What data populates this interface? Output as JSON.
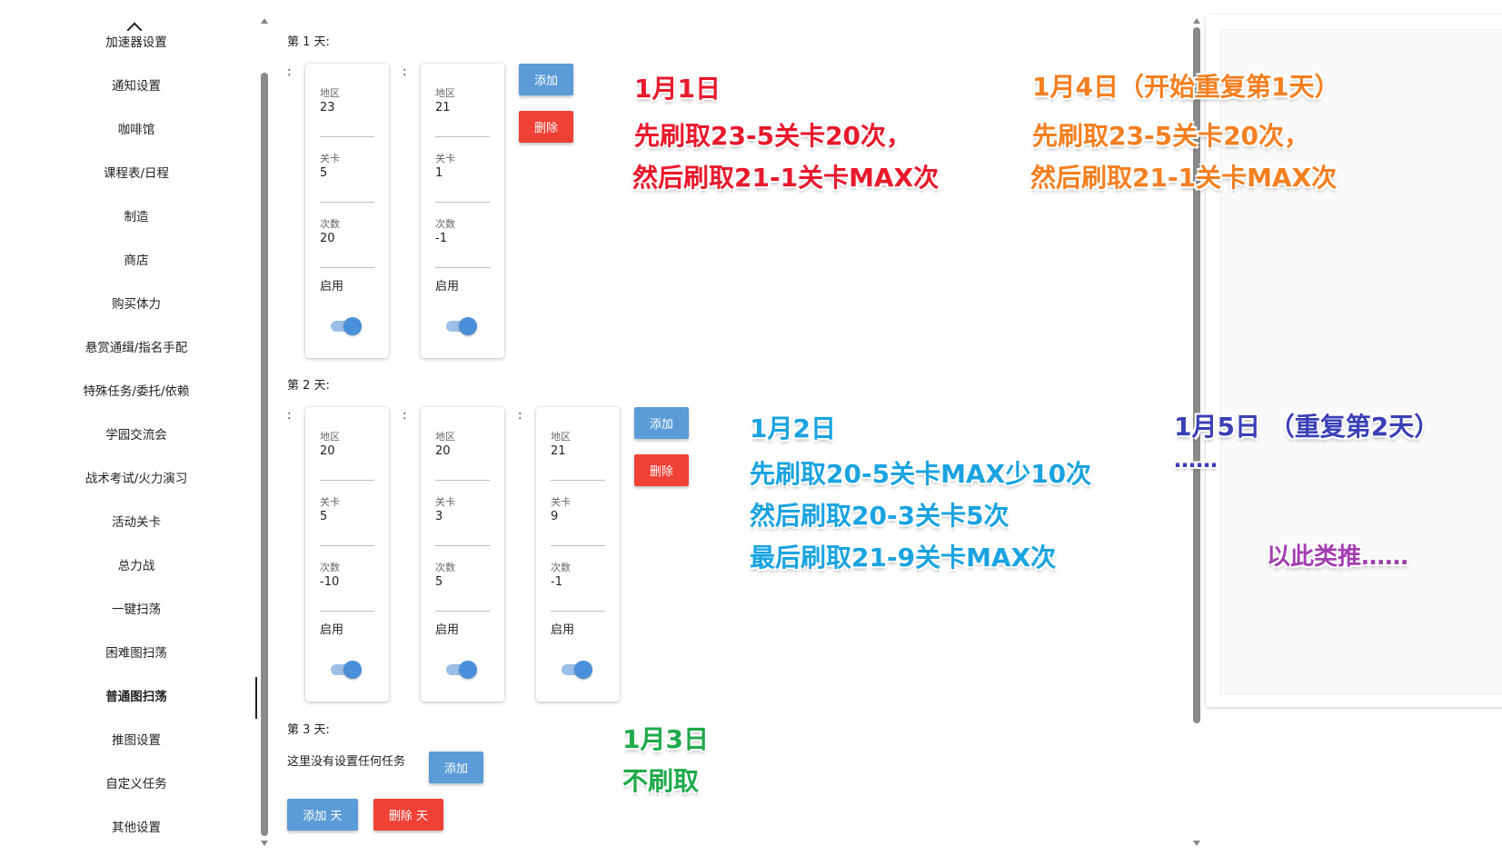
{
  "sidebar": {
    "items": [
      {
        "label": "加速器设置",
        "active": false
      },
      {
        "label": "通知设置",
        "active": false
      },
      {
        "label": "咖啡馆",
        "active": false
      },
      {
        "label": "课程表/日程",
        "active": false
      },
      {
        "label": "制造",
        "active": false
      },
      {
        "label": "商店",
        "active": false
      },
      {
        "label": "购买体力",
        "active": false
      },
      {
        "label": "悬赏通缉/指名手配",
        "active": false
      },
      {
        "label": "特殊任务/委托/依赖",
        "active": false
      },
      {
        "label": "学园交流会",
        "active": false
      },
      {
        "label": "战术考试/火力演习",
        "active": false
      },
      {
        "label": "活动关卡",
        "active": false
      },
      {
        "label": "总力战",
        "active": false
      },
      {
        "label": "一键扫荡",
        "active": false
      },
      {
        "label": "困难图扫荡",
        "active": false
      },
      {
        "label": "普通图扫荡",
        "active": true
      },
      {
        "label": "推图设置",
        "active": false
      },
      {
        "label": "自定义任务",
        "active": false
      },
      {
        "label": "其他设置",
        "active": false
      }
    ]
  },
  "labels": {
    "area": "地区",
    "stage": "关卡",
    "count": "次数",
    "enable": "启用",
    "add": "添加",
    "delete": "删除",
    "colon": ":"
  },
  "days": [
    {
      "label": "第 1 天:",
      "tasks": [
        {
          "area": "23",
          "stage": "5",
          "count": "20",
          "enabled": true
        },
        {
          "area": "21",
          "stage": "1",
          "count": "-1",
          "enabled": true
        }
      ]
    },
    {
      "label": "第 2 天:",
      "tasks": [
        {
          "area": "20",
          "stage": "5",
          "count": "-10",
          "enabled": true
        },
        {
          "area": "20",
          "stage": "3",
          "count": "5",
          "enabled": true
        },
        {
          "area": "21",
          "stage": "9",
          "count": "-1",
          "enabled": true
        }
      ]
    },
    {
      "label": "第 3 天:",
      "tasks": [],
      "empty_message": "这里没有设置任何任务"
    }
  ],
  "footer": {
    "add_day": "添加 天",
    "delete_day": "删除 天"
  },
  "annotations": {
    "jan1": {
      "lines": [
        "1月1日",
        "先刷取23-5关卡20次，",
        "然后刷取21-1关卡MAX次"
      ],
      "color": "#e8192c"
    },
    "jan2": {
      "lines": [
        "1月2日",
        "先刷取20-5关卡MAX少10次",
        "然后刷取20-3关卡5次",
        "最后刷取21-9关卡MAX次"
      ],
      "color": "#1aa3e0"
    },
    "jan3": {
      "lines": [
        "1月3日",
        "不刷取"
      ],
      "color": "#1faa4b"
    },
    "jan4": {
      "lines": [
        "1月4日（开始重复第1天）",
        "先刷取23-5关卡20次，",
        "然后刷取21-1关卡MAX次"
      ],
      "color": "#f47f20"
    },
    "jan5": {
      "lines": [
        "1月5日 （重复第2天）",
        "……"
      ],
      "color": "#3b3fb5"
    },
    "etc": {
      "lines": [
        "以此类推……"
      ],
      "color": "#a23fb0"
    }
  }
}
